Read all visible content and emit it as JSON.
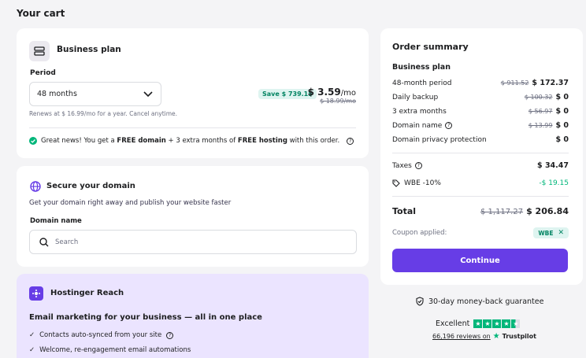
{
  "page_title": "Your cart",
  "plan": {
    "title": "Business plan",
    "period_label": "Period",
    "period_value": "48 months",
    "save_badge": "Save $ 739.15",
    "price": "$ 3.59",
    "price_unit": "/mo",
    "old_price": "$ 18.99/mo",
    "renews_note": "Renews at $ 16.99/mo for a year. Cancel anytime.",
    "great_news_pre": "Great news! You get a ",
    "great_news_free_domain": "FREE domain",
    "great_news_mid": " + 3 extra months of ",
    "great_news_free_hosting": "FREE hosting",
    "great_news_post": " with this order."
  },
  "domain": {
    "title": "Secure your domain",
    "subtitle": "Get your domain right away and publish your website faster",
    "field_label": "Domain name",
    "search_placeholder": "Search"
  },
  "reach": {
    "title": "Hostinger Reach",
    "headline": "Email marketing for your business — all in one place",
    "features": [
      "Contacts auto-synced from your site",
      "Welcome, re-engagement email automations"
    ]
  },
  "summary": {
    "title": "Order summary",
    "plan_name": "Business plan",
    "lines": [
      {
        "label": "48-month period",
        "old": "$ 911.52",
        "value": "$ 172.37"
      },
      {
        "label": "Daily backup",
        "old": "$ 100.32",
        "value": "$ 0"
      },
      {
        "label": "3 extra months",
        "old": "$ 56.97",
        "value": "$ 0"
      },
      {
        "label": "Domain name",
        "old": "$ 13.99",
        "value": "$ 0"
      },
      {
        "label": "Domain privacy protection",
        "old": "",
        "value": "$ 0"
      }
    ],
    "taxes_label": "Taxes",
    "taxes_value": "$ 34.47",
    "discount_label": "WBE -10%",
    "discount_value": "-$ 19.15",
    "total_label": "Total",
    "total_old": "$ 1,117.27",
    "total_value": "$ 206.84",
    "coupon_label": "Coupon applied:",
    "coupon_code": "WBE",
    "continue_label": "Continue"
  },
  "guarantee": "30-day money-back guarantee",
  "trust": {
    "excellent": "Excellent",
    "reviews": "66,196 reviews on",
    "brand": "Trustpilot",
    "rating_stars": 4.5
  },
  "colors": {
    "accent": "#673de6",
    "success": "#00b67a",
    "discount_green": "#008361"
  }
}
